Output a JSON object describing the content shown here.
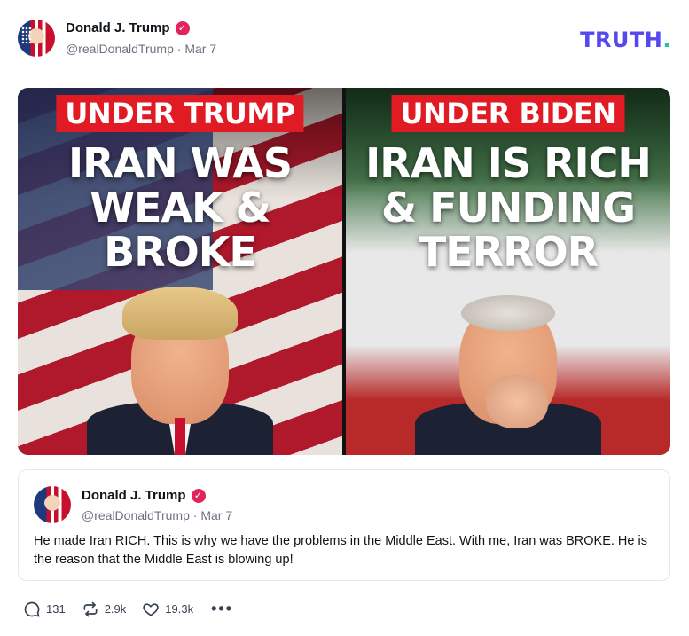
{
  "post": {
    "author_name": "Donald J. Trump",
    "handle": "@realDonaldTrump",
    "separator": "·",
    "date": "Mar 7",
    "verified_mark": "✓",
    "avatar_icon": "avatar"
  },
  "brand": {
    "logo_text": "TRUTH",
    "logo_dot": ".",
    "color": "#5448ee",
    "dot_color": "#22c3a6"
  },
  "media": {
    "left": {
      "banner": "UNDER TRUMP",
      "headline": [
        "IRAN WAS",
        "WEAK &",
        "BROKE"
      ]
    },
    "right": {
      "banner": "UNDER BIDEN",
      "headline": [
        "IRAN IS RICH",
        "& FUNDING",
        "TERROR"
      ]
    },
    "banner_color": "#e01b24"
  },
  "quoted_post": {
    "author_name": "Donald J. Trump",
    "handle": "@realDonaldTrump",
    "separator": "·",
    "date": "Mar 7",
    "verified_mark": "✓",
    "text": "He made Iran RICH. This is why we have the problems in the Middle East. With me, Iran was BROKE. He is the reason that the Middle East is blowing up!"
  },
  "actions": {
    "replies": {
      "icon": "reply-icon",
      "count": "131"
    },
    "retruths": {
      "icon": "retruth-icon",
      "count": "2.9k"
    },
    "likes": {
      "icon": "heart-icon",
      "count": "19.3k"
    },
    "more": {
      "icon": "more-icon",
      "label": "•••"
    }
  },
  "colors": {
    "verified": "#e0245e",
    "text_muted": "#6b7280"
  }
}
